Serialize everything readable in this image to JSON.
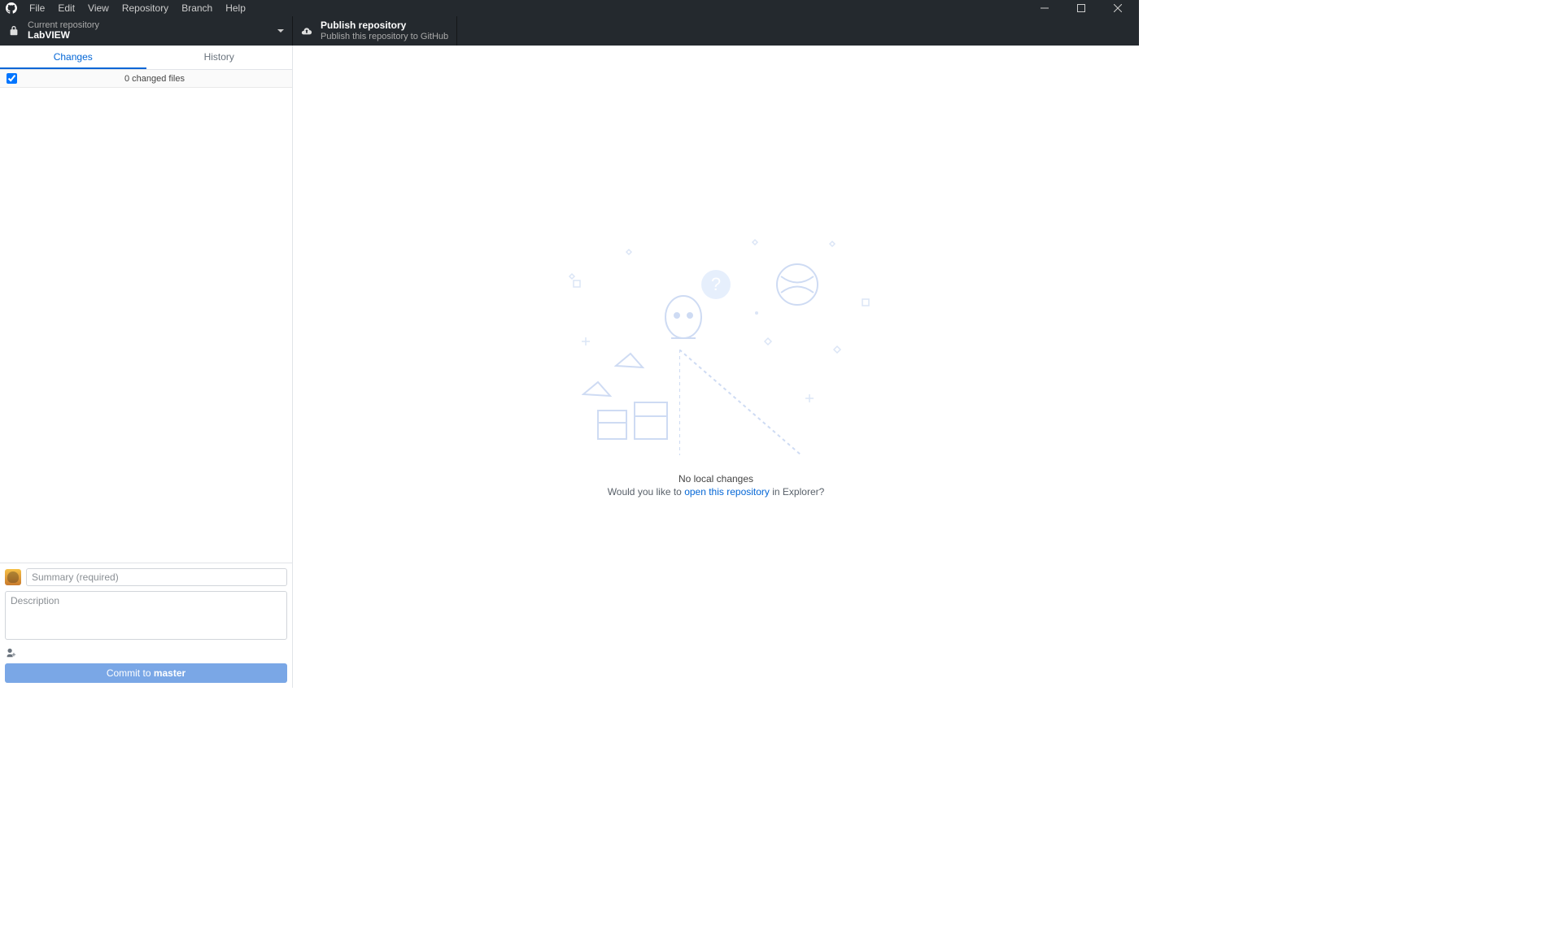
{
  "menu": [
    "File",
    "Edit",
    "View",
    "Repository",
    "Branch",
    "Help"
  ],
  "toolbar": {
    "repo_label": "Current repository",
    "repo_name": "LabVIEW",
    "publish_label": "Publish repository",
    "publish_sub": "Publish this repository to GitHub"
  },
  "tabs": {
    "changes": "Changes",
    "history": "History"
  },
  "changes": {
    "header": "0 changed files"
  },
  "commit": {
    "summary_ph": "Summary (required)",
    "desc_ph": "Description",
    "btn_prefix": "Commit to ",
    "btn_branch": "master"
  },
  "empty": {
    "title": "No local changes",
    "pre": "Would you like to ",
    "link": "open this repository",
    "post": " in Explorer?"
  }
}
